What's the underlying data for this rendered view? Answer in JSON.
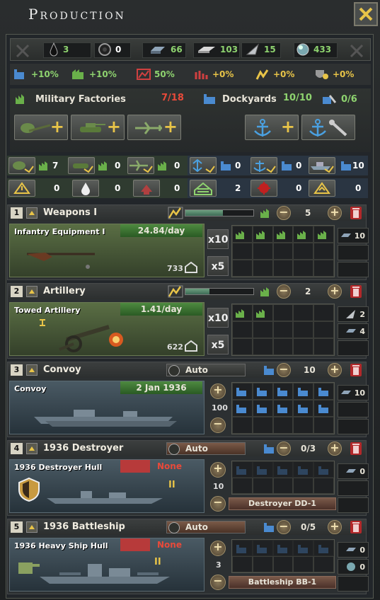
{
  "title": "Production",
  "resources": [
    {
      "icon": "oil-icon",
      "value": "3",
      "color": "#8ed36f"
    },
    {
      "icon": "rubber-icon",
      "value": "0",
      "color": "#ffffff"
    },
    {
      "icon": "steel-icon",
      "value": "66",
      "color": "#8ed36f"
    },
    {
      "icon": "aluminium-icon",
      "value": "103",
      "color": "#8ed36f"
    },
    {
      "icon": "tungsten-icon",
      "value": "15",
      "color": "#8ed36f"
    },
    {
      "icon": "chromium-icon",
      "value": "433",
      "color": "#8ed36f"
    }
  ],
  "modifiers": [
    {
      "icon": "dockyard-output-icon",
      "value": "+10%",
      "color": "#8ed36f"
    },
    {
      "icon": "factory-output-icon",
      "value": "+10%",
      "color": "#8ed36f"
    },
    {
      "icon": "efficiency-cap-icon",
      "value": "50%",
      "color": "#8ed36f"
    },
    {
      "icon": "efficiency-growth-icon",
      "value": "+0%",
      "color": "#e8c448"
    },
    {
      "icon": "efficiency-retention-icon",
      "value": "+0%",
      "color": "#e8c448"
    },
    {
      "icon": "resource-gain-icon",
      "value": "+0%",
      "color": "#e8c448"
    }
  ],
  "military_factories": {
    "label": "Military Factories",
    "used": "7/18"
  },
  "dockyards": {
    "label": "Dockyards",
    "used": "10/10",
    "repair": "0/6"
  },
  "slots_row1": [
    "7",
    "0",
    "0",
    "0",
    "0",
    "10"
  ],
  "slots_row2": [
    "0",
    "0",
    "0",
    "2",
    "0",
    "0"
  ],
  "queue": [
    {
      "num": "1",
      "name": "Weapons I",
      "count": "5",
      "item": "Infantry Equipment I",
      "rate": "24.84/day",
      "total": "733",
      "x10": "x10",
      "x5": "x5",
      "res": [
        "10"
      ],
      "bar": 0.55
    },
    {
      "num": "2",
      "name": "Artillery",
      "count": "2",
      "item": "Towed Artillery",
      "rate": "1.41/day",
      "total": "622",
      "x10": "x10",
      "x5": "x5",
      "res": [
        "2",
        "4"
      ],
      "bar": 0.35
    },
    {
      "num": "3",
      "name": "Convoy",
      "mode": "Auto",
      "count": "10",
      "item": "Convoy",
      "rate": "2 Jan 1936",
      "total": "100",
      "res": [
        "10"
      ]
    },
    {
      "num": "4",
      "name": "1936 Destroyer",
      "mode": "Auto",
      "count": "0/3",
      "item": "1936 Destroyer Hull",
      "rate": "None",
      "total": "10",
      "variant": "Destroyer DD-1",
      "res": [
        "0"
      ]
    },
    {
      "num": "5",
      "name": "1936 Battleship",
      "mode": "Auto",
      "count": "0/5",
      "item": "1936 Heavy Ship Hull",
      "rate": "None",
      "total": "3",
      "variant": "Battleship BB-1",
      "res": [
        "0",
        "0"
      ]
    }
  ]
}
